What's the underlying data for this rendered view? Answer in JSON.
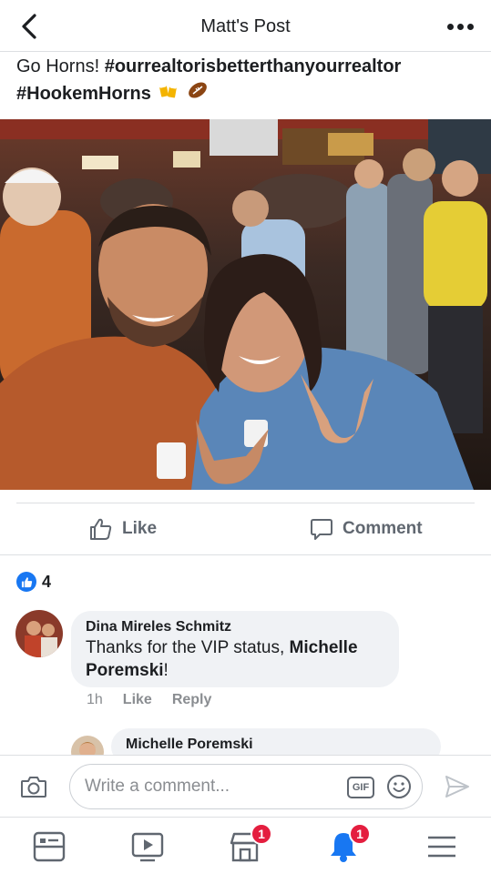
{
  "header": {
    "title": "Matt's Post",
    "back_icon": "chevron-left-icon",
    "more_icon": "more-horizontal-icon"
  },
  "post": {
    "text_plain": "Go Horns! ",
    "hashtag1": "#ourrealtorisbetterthanyourrealtor",
    "hashtag2": "#HookemHorns"
  },
  "actions": {
    "like_label": "Like",
    "comment_label": "Comment"
  },
  "reactions": {
    "count": "4"
  },
  "comments": [
    {
      "author": "Dina Mireles Schmitz",
      "text_before": "Thanks for the VIP status, ",
      "mention": "Michelle Poremski",
      "text_after": "!",
      "time": "1h",
      "like_label": "Like",
      "reply_label": "Reply"
    },
    {
      "author": "Michelle Poremski"
    }
  ],
  "composer": {
    "placeholder": "Write a comment...",
    "gif_label": "GIF"
  },
  "bottom_nav": {
    "marketplace_badge": "1",
    "notifications_badge": "1"
  },
  "colors": {
    "accent": "#1877f2",
    "badge": "#e41e3f",
    "secondary_text": "#606770"
  }
}
